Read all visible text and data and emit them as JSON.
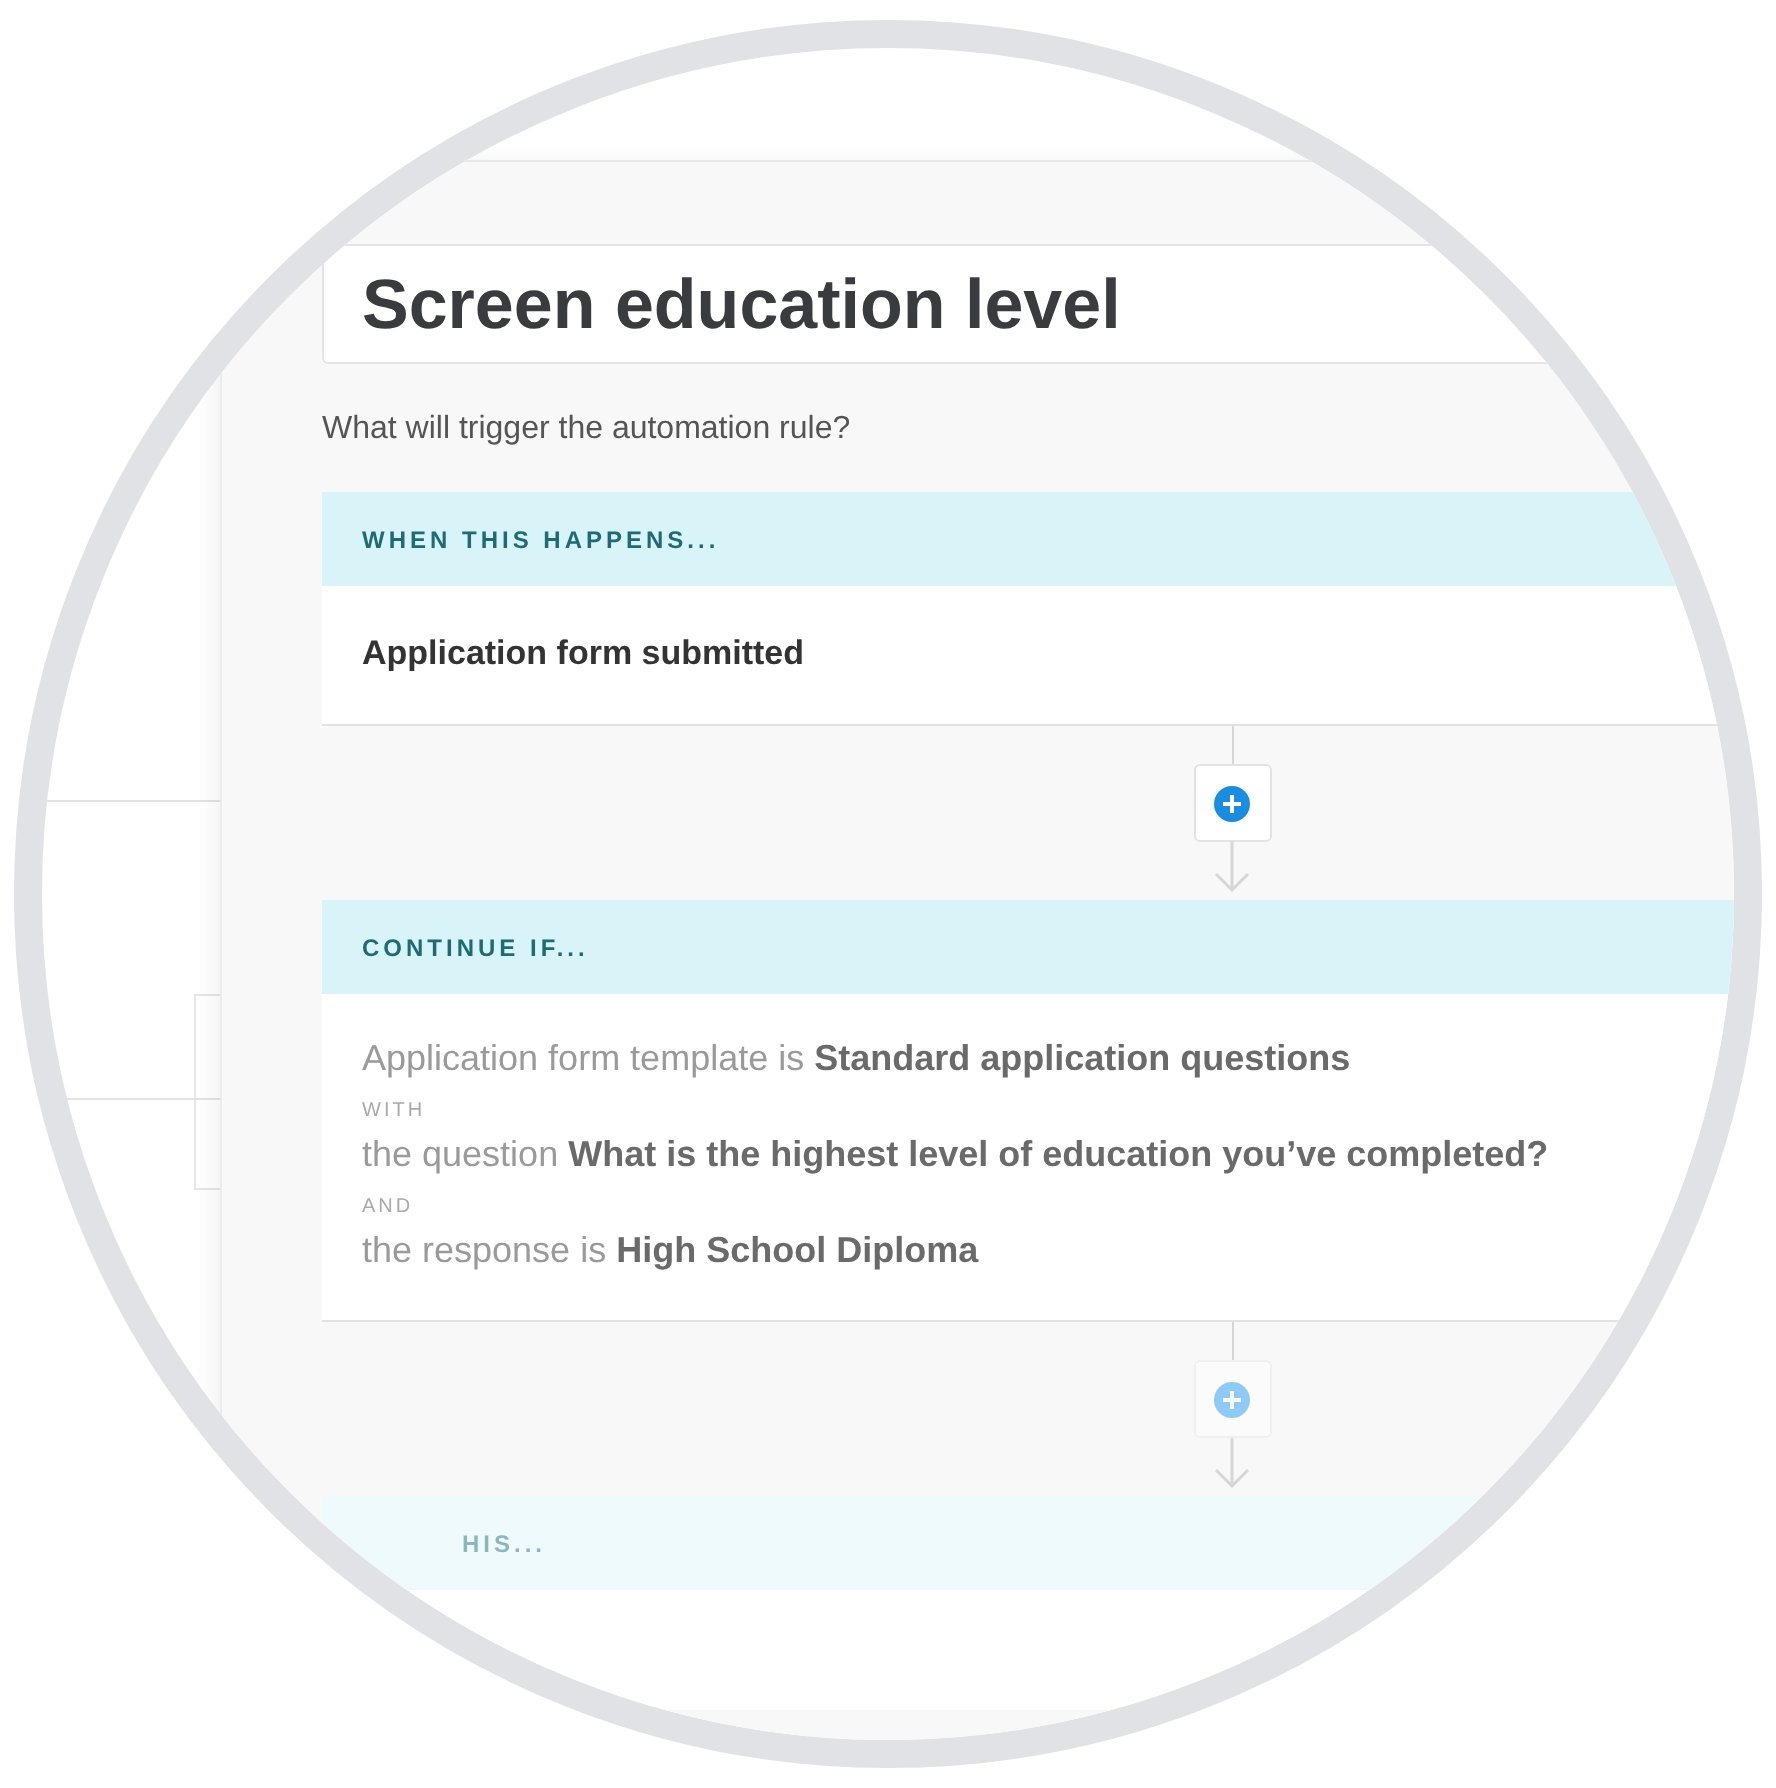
{
  "rule_name": {
    "value": "Screen education level"
  },
  "prompt": "What will trigger the automation rule?",
  "sections": [
    {
      "kind": "trigger",
      "header": "WHEN THIS HAPPENS...",
      "lines": [
        {
          "text": "Application form submitted"
        }
      ]
    },
    {
      "kind": "condition",
      "header": "CONTINUE IF...",
      "lines": [
        {
          "text": "Application form template is **Standard application questions**"
        },
        {
          "joiner": "WITH",
          "text": "the question **What is the highest level of education you’ve completed?**"
        },
        {
          "joiner": "AND",
          "text": "the response is **High School Diploma**"
        }
      ]
    },
    {
      "kind": "action",
      "header": "HIS..."
    }
  ],
  "connectors": [
    {
      "disabled": false
    },
    {
      "disabled": true
    }
  ]
}
